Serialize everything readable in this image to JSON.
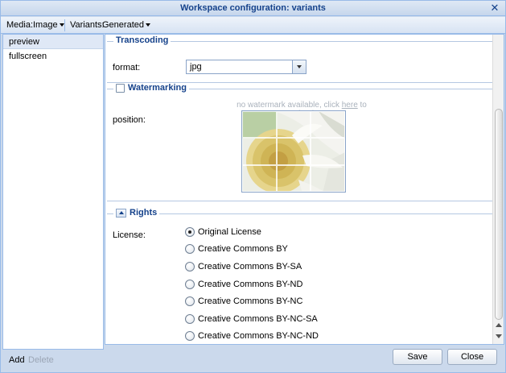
{
  "window": {
    "title": "Workspace configuration: variants"
  },
  "toolbar": {
    "media_label": "Media:",
    "media_value": "Image",
    "variants_label": "Variants:",
    "variants_value": "Generated"
  },
  "variants_list": {
    "items": [
      {
        "label": "preview",
        "selected": true
      },
      {
        "label": "fullscreen",
        "selected": false
      }
    ],
    "add_label": "Add",
    "delete_label": "Delete"
  },
  "transcoding": {
    "legend": "Transcoding",
    "format_label": "format:",
    "format_value": "jpg"
  },
  "watermarking": {
    "legend": "Watermarking",
    "note_prefix": "no watermark available, click",
    "note_link": "here",
    "note_suffix": "to upload",
    "position_label": "position:"
  },
  "rights": {
    "legend": "Rights",
    "license_label": "License:",
    "options": [
      {
        "label": "Original License",
        "checked": true
      },
      {
        "label": "Creative Commons BY",
        "checked": false
      },
      {
        "label": "Creative Commons BY-SA",
        "checked": false
      },
      {
        "label": "Creative Commons BY-ND",
        "checked": false
      },
      {
        "label": "Creative Commons BY-NC",
        "checked": false
      },
      {
        "label": "Creative Commons BY-NC-SA",
        "checked": false
      },
      {
        "label": "Creative Commons BY-NC-ND",
        "checked": false
      }
    ]
  },
  "footer": {
    "save_label": "Save",
    "close_label": "Close"
  },
  "colors": {
    "title_text": "#15428b",
    "panel_border": "#99bbe8",
    "frame_bg": "#cbd9ec"
  }
}
